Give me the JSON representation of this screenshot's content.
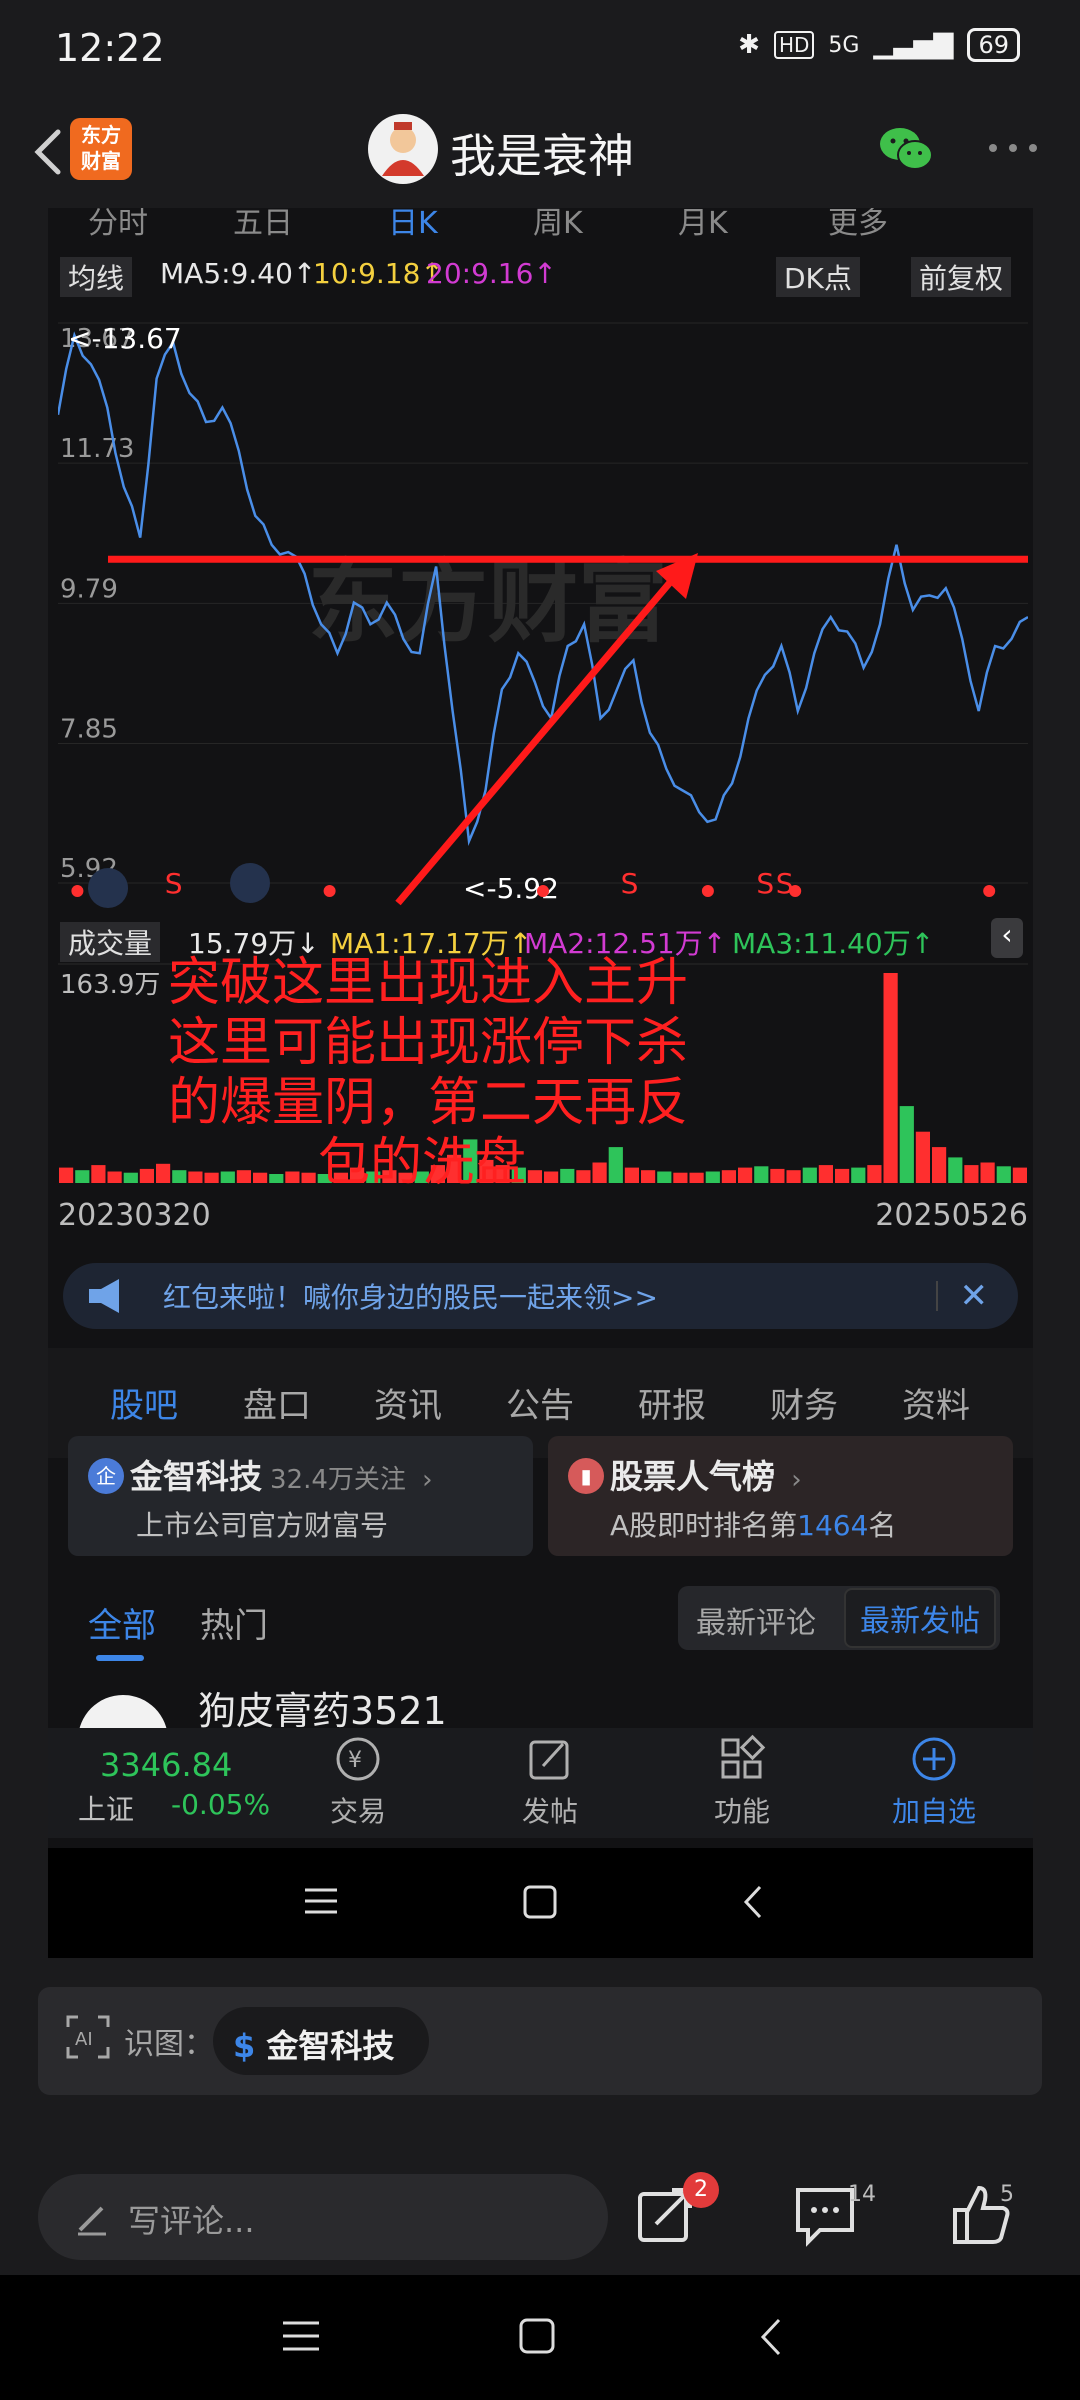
{
  "status_bar": {
    "time": "12:22",
    "network": "5G",
    "hd": "HD",
    "battery": "69"
  },
  "header": {
    "app_logo_line1": "东方",
    "app_logo_line2": "财富",
    "title": "我是衰神"
  },
  "chart_tabs": [
    "分时",
    "五日",
    "日K",
    "周K",
    "月K",
    "更多"
  ],
  "ma_bar": {
    "mode": "均线",
    "ma5": "MA5:9.40↑",
    "ma10": "10:9.18↑",
    "ma20": "20:9.16↑",
    "dk": "DK点",
    "adjust": "前复权"
  },
  "price_axis": {
    "labels": [
      "13.67",
      "11.73",
      "9.79",
      "7.85",
      "5.92"
    ]
  },
  "price_marks": {
    "high": "<-13.67",
    "low": "<-5.92",
    "s_marker": "S"
  },
  "volume_bar": {
    "mode": "成交量",
    "vol": "15.79万↓",
    "ma1": "MA1:17.17万↑",
    "ma2": "MA2:12.51万↑",
    "ma3": "MA3:11.40万↑",
    "max_label": "163.9万"
  },
  "dates": {
    "start": "20230320",
    "end": "20250526"
  },
  "annotation": {
    "line1": "突破这里出现进入主升",
    "line2": "这里可能出现涨停下杀",
    "line3": "的爆量阴，第二天再反",
    "line4": "包的洗盘"
  },
  "chart_data": {
    "type": "line",
    "x_range": [
      "20230320",
      "20250526"
    ],
    "ylim": [
      5.92,
      13.67
    ],
    "y_ticks": [
      13.67,
      11.73,
      9.79,
      7.85,
      5.92
    ],
    "resistance_level": 10.4,
    "series": [
      {
        "values": [
          12.4,
          13.5,
          13.1,
          12.5,
          11.4,
          10.7,
          12.9,
          13.4,
          12.7,
          12.3,
          12.5,
          11.9,
          11.0,
          10.6,
          10.5,
          10.2,
          9.5,
          9.1,
          9.8,
          9.5,
          9.8,
          9.3,
          9.1,
          10.3,
          8.3,
          6.5,
          7.2,
          8.6,
          9.1,
          8.7,
          8.2,
          9.2,
          9.5,
          8.2,
          8.6,
          9.0,
          8.0,
          7.5,
          7.2,
          6.9,
          6.8,
          7.3,
          8.2,
          8.8,
          9.2,
          8.3,
          9.1,
          9.6,
          9.4,
          8.9,
          9.5,
          10.6,
          9.7,
          9.9,
          10.0,
          9.3,
          8.3,
          9.2,
          9.3,
          9.6
        ]
      }
    ],
    "volume": {
      "ylim": [
        0,
        163.9
      ],
      "unit": "万",
      "values": [
        12,
        10,
        14,
        9,
        8,
        11,
        15,
        10,
        9,
        8,
        9,
        10,
        8,
        7,
        9,
        8,
        7,
        8,
        12,
        9,
        10,
        8,
        9,
        14,
        22,
        34,
        18,
        14,
        12,
        10,
        9,
        11,
        10,
        16,
        28,
        12,
        10,
        9,
        8,
        8,
        9,
        10,
        12,
        13,
        11,
        10,
        12,
        14,
        11,
        12,
        14,
        163.9,
        60,
        40,
        28,
        20,
        14,
        16,
        13,
        12
      ]
    },
    "s_markers": 4,
    "red_dots": 7
  },
  "promo": {
    "text": "红包来啦！喊你身边的股民一起来领>>"
  },
  "sub_tabs": [
    "股吧",
    "盘口",
    "资讯",
    "公告",
    "研报",
    "财务",
    "资料"
  ],
  "cards": {
    "left": {
      "badge": "企",
      "title": "金智科技",
      "count": "32.4万关注",
      "sub": "上市公司官方财富号"
    },
    "right": {
      "title": "股票人气榜",
      "sub_prefix": "A股即时排名第",
      "rank": "1464",
      "sub_suffix": "名"
    }
  },
  "filters": {
    "all": "全部",
    "hot": "热门",
    "latest_comment": "最新评论",
    "latest_post": "最新发帖"
  },
  "feed": {
    "first_user": "狗皮膏药3521"
  },
  "bottom_nav": {
    "index_value": "3346.84",
    "index_name": "上证",
    "index_change": "-0.05%",
    "items": [
      "交易",
      "发帖",
      "功能",
      "加自选"
    ]
  },
  "ai_bar": {
    "label": "识图：",
    "chip": "金智科技",
    "chip_symbol": "$"
  },
  "comment_bar": {
    "placeholder": "写评论...",
    "share_badge": "2",
    "comments": "14",
    "likes": "5"
  },
  "colors": {
    "accent": "#3d86e8",
    "up": "#ff2f2f",
    "down": "#2ec45a",
    "price_line": "#4a8ee8",
    "ma10": "#f4d03f",
    "ma20": "#d23bd2"
  }
}
